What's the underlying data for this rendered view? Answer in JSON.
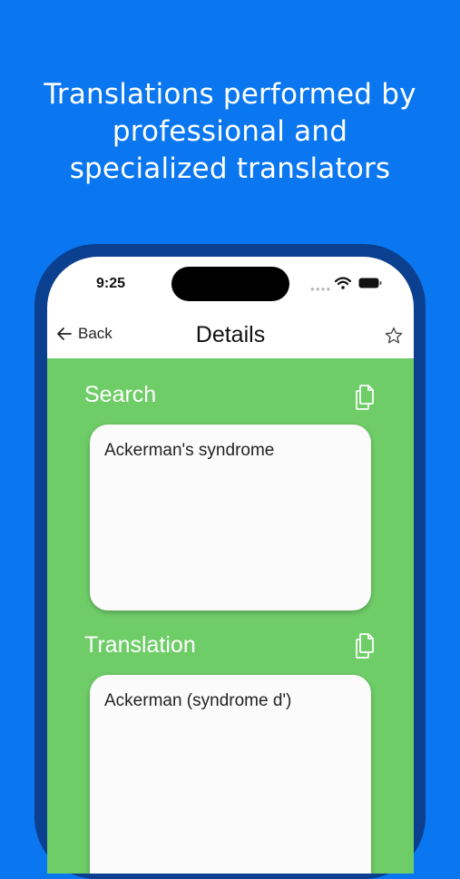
{
  "headline": {
    "line1": "Translations performed by",
    "line2": "professional and",
    "line3": "specialized translators"
  },
  "status_bar": {
    "time": "9:25",
    "icons": [
      "signal-dots-icon",
      "wifi-icon",
      "battery-icon"
    ]
  },
  "nav": {
    "back_label": "Back",
    "title": "Details",
    "icons": [
      "back-arrow-icon",
      "star-icon"
    ]
  },
  "search_section": {
    "label": "Search",
    "text": "Ackerman's syndrome",
    "icon": "copy-icon"
  },
  "translation_section": {
    "label": "Translation",
    "text": "Ackerman (syndrome d')",
    "icon": "copy-icon"
  },
  "colors": {
    "background": "#0a77f0",
    "phone_frame": "#0b3f8f",
    "content_bg": "#6fcd68",
    "card_bg": "#fbfbfb"
  }
}
